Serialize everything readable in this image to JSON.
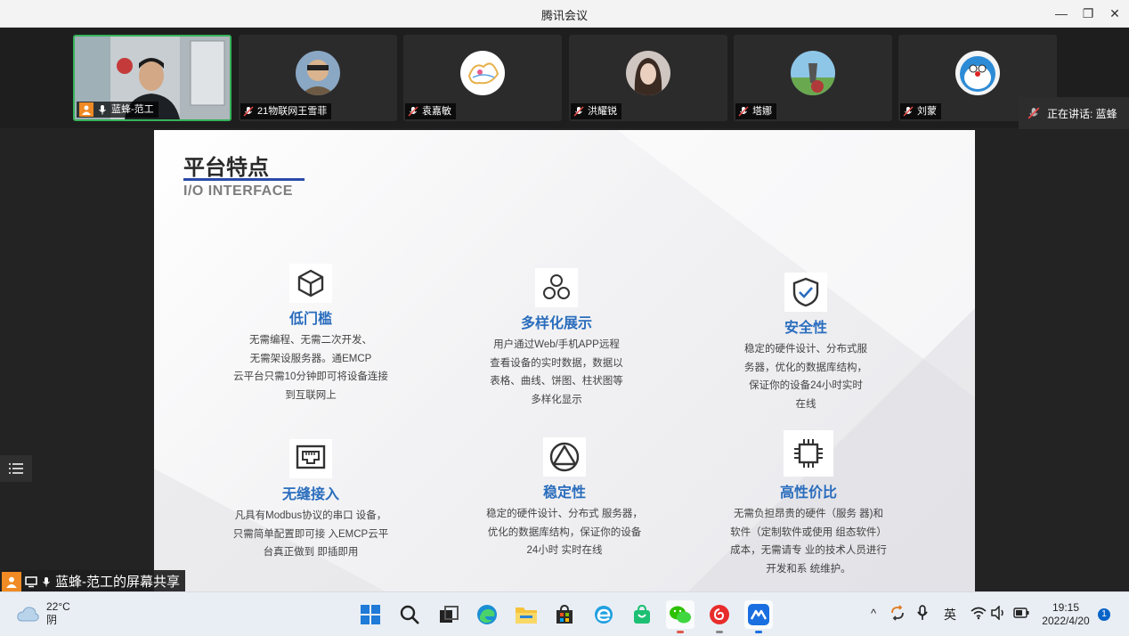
{
  "window": {
    "title": "腾讯会议",
    "minimize_glyph": "—",
    "restore_glyph": "❐",
    "close_glyph": "✕"
  },
  "participants": [
    {
      "name": "蓝蜂-范工",
      "has_video": true,
      "mic": "on",
      "host": true
    },
    {
      "name": "21物联网王雪菲",
      "mic": "muted"
    },
    {
      "name": "袁嘉敏",
      "mic": "muted"
    },
    {
      "name": "洪耀锐",
      "mic": "muted"
    },
    {
      "name": "塔娜",
      "mic": "muted"
    },
    {
      "name": "刘蒙",
      "mic": "muted"
    }
  ],
  "speaking": {
    "label": "正在讲话: 蓝蜂"
  },
  "share_label": "蓝蜂-范工的屏幕共享",
  "slide": {
    "title": "平台特点",
    "subtitle": "I/O INTERFACE",
    "features": [
      {
        "icon": "cube-icon",
        "heading": "低门槛",
        "body": "无需编程、无需二次开发、\n无需架设服务器。通EMCP\n云平台只需10分钟即可将设备连接\n到互联网上"
      },
      {
        "icon": "hexagons-icon",
        "heading": "多样化展示",
        "body": "用户通过Web/手机APP远程\n查看设备的实时数据，数据以\n表格、曲线、饼图、柱状图等\n多样化显示"
      },
      {
        "icon": "shield-check-icon",
        "heading": "安全性",
        "body": "稳定的硬件设计、分布式服\n务器，优化的数据库结构，\n保证你的设备24小时实时\n在线"
      },
      {
        "icon": "ethernet-port-icon",
        "heading": "无缝接入",
        "body": "凡具有Modbus协议的串口 设备，\n只需简单配置即可接 入EMCP云平\n台真正做到 即插即用"
      },
      {
        "icon": "triangle-circle-icon",
        "heading": "稳定性",
        "body": "稳定的硬件设计、分布式 服务器，\n优化的数据库结构，保证你的设备\n24小时 实时在线"
      },
      {
        "icon": "chip-icon",
        "heading": "高性价比",
        "body": "无需负担昂贵的硬件（服务 器)和\n软件（定制软件或使用 组态软件）\n成本，无需请专 业的技术人员进行\n开发和系 统维护。"
      }
    ]
  },
  "taskbar": {
    "weather": {
      "temp": "22°C",
      "desc": "阴"
    },
    "apps": [
      "windows-start",
      "search",
      "task-view",
      "edge",
      "file-explorer",
      "microsoft-store",
      "ie",
      "store-bag",
      "wechat",
      "netease-music",
      "tencent-meeting"
    ],
    "tray": {
      "chevron": "^",
      "ime": "英"
    },
    "clock": {
      "time": "19:15",
      "date": "2022/4/20"
    },
    "notifications": "1"
  },
  "colors": {
    "accent_blue": "#2a6dbd",
    "underline": "#2b4ba8",
    "active_green": "#36b35a",
    "host_orange": "#f08a24"
  }
}
